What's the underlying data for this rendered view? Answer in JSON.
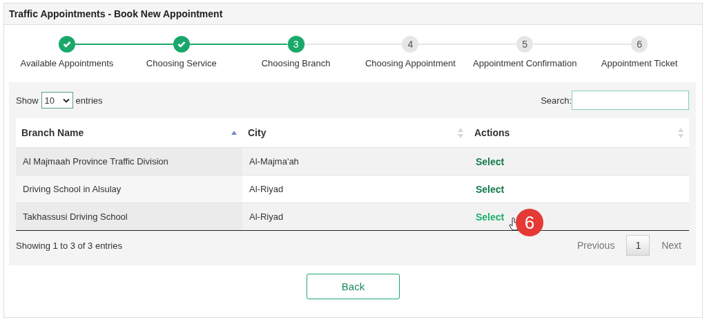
{
  "window": {
    "title": "Traffic Appointments - Book New Appointment"
  },
  "steps": [
    {
      "label": "Available Appointments",
      "completed": true,
      "selected": false
    },
    {
      "label": "Choosing Service",
      "completed": true,
      "selected": false
    },
    {
      "number": "3",
      "label": "Choosing Branch",
      "completed": false,
      "selected": true
    },
    {
      "number": "4",
      "label": "Choosing Appointment",
      "completed": false,
      "selected": false
    },
    {
      "number": "5",
      "label": "Appointment Confirmation",
      "completed": false,
      "selected": false
    },
    {
      "number": "6",
      "label": "Appointment Ticket",
      "completed": false,
      "selected": false
    }
  ],
  "length": {
    "before": "Show",
    "value": "10",
    "after": "entries"
  },
  "search": {
    "label": "Search:"
  },
  "table": {
    "columns": [
      {
        "label": "Branch Name",
        "sorted": true
      },
      {
        "label": "City",
        "sorted": false
      },
      {
        "label": "Actions",
        "sorted": false
      }
    ],
    "rows": [
      {
        "cells": [
          "Al Majmaah Province Traffic Division",
          "Al-Majma'ah"
        ],
        "action": "Select",
        "hovered": false
      },
      {
        "cells": [
          "Driving School in Alsulay",
          "Al-Riyad"
        ],
        "action": "Select",
        "hovered": false
      },
      {
        "cells": [
          "Takhassusi Driving School",
          "Al-Riyad"
        ],
        "action": "Select",
        "hovered": true
      }
    ]
  },
  "info": "Showing 1 to 3 of 3 entries",
  "pagination": [
    {
      "label": "Previous",
      "selected": false
    },
    {
      "label": "1",
      "selected": true
    },
    {
      "label": "Next",
      "selected": false
    }
  ],
  "callout": "6",
  "back_button": "Back"
}
